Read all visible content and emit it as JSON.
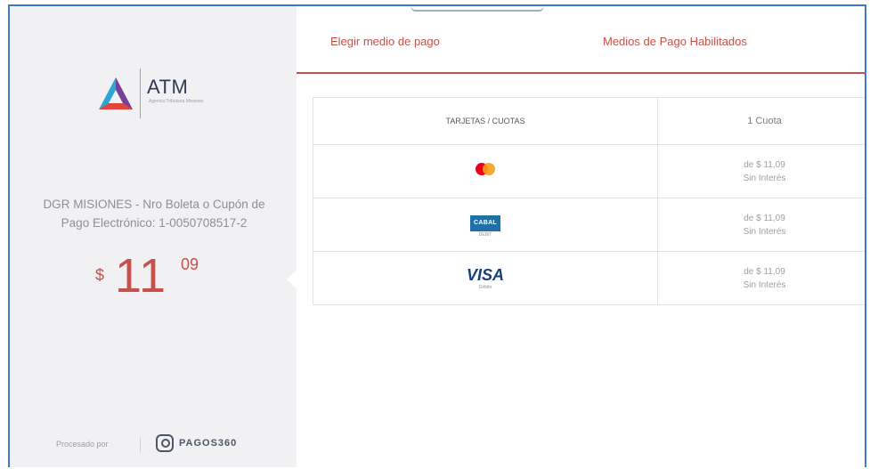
{
  "sidebar": {
    "logo": {
      "text": "ATM",
      "sub": "Agencia Tributaria Misiones"
    },
    "description": "DGR MISIONES - Nro Boleta o Cupón de Pago Electrónico: 1-0050708517-2",
    "amount": {
      "currency": "$",
      "integer": "11",
      "decimals": "09"
    },
    "powered_by": {
      "label": "Procesado por",
      "provider": "PAGOS360"
    }
  },
  "tabs": [
    {
      "label": "Elegir medio de pago"
    },
    {
      "label": "Medios de Pago Habilitados"
    }
  ],
  "table": {
    "headers": [
      "TARJETAS / CUOTAS",
      "1 Cuota"
    ],
    "rows": [
      {
        "card": "mastercard",
        "amount": "de $ 11,09",
        "interest": "Sin Interés"
      },
      {
        "card": "cabal",
        "card_label": "CABAL",
        "card_sub": "DEBIT",
        "amount": "de $ 11,09",
        "interest": "Sin Interés"
      },
      {
        "card": "visa",
        "card_label": "VISA",
        "card_sub": "Débito",
        "amount": "de $ 11,09",
        "interest": "Sin Interés"
      }
    ]
  },
  "colors": {
    "accent": "#c8504a",
    "sidebar_bg": "#f1f1f3",
    "frame_border": "#3b78c8"
  }
}
